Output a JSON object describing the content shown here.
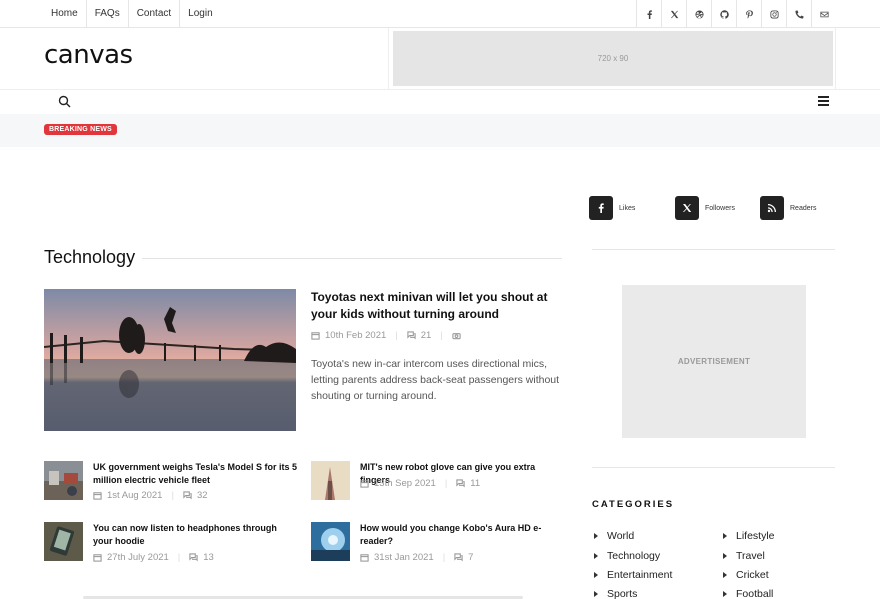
{
  "topnav": [
    "Home",
    "FAQs",
    "Contact",
    "Login"
  ],
  "social_icons": [
    "facebook-icon",
    "x-icon",
    "dribbble-icon",
    "github-icon",
    "pinterest-icon",
    "instagram-icon",
    "phone-icon",
    "email-icon"
  ],
  "header": {
    "logo": "canvas",
    "banner_text": "720 x 90"
  },
  "breaking": {
    "badge": "BREAKING NEWS"
  },
  "section": {
    "title": "Technology"
  },
  "featured": {
    "title": "Toyotas next minivan will let you shout at your kids without turning around",
    "date": "10th Feb 2021",
    "comments": "21",
    "excerpt": "Toyota's new in-car intercom uses directional mics, letting parents address back-seat passengers without shouting or turning around."
  },
  "posts": [
    {
      "title": "UK government weighs Tesla's Model S for its 5 million electric vehicle fleet",
      "date": "1st Aug 2021",
      "comments": "32"
    },
    {
      "title": "MIT's new robot glove can give you extra fingers",
      "date": "13th Sep 2021",
      "comments": "11"
    },
    {
      "title": "You can now listen to headphones through your hoodie",
      "date": "27th July 2021",
      "comments": "13"
    },
    {
      "title": "How would you change Kobo's Aura HD e-reader?",
      "date": "31st Jan 2021",
      "comments": "7"
    }
  ],
  "sidebar": {
    "social": [
      {
        "icon": "facebook-icon",
        "label": "Likes"
      },
      {
        "icon": "x-icon",
        "label": "Followers"
      },
      {
        "icon": "rss-icon",
        "label": "Readers"
      }
    ],
    "ad_text": "ADVERTISEMENT",
    "categories_title": "CATEGORIES",
    "categories": [
      "World",
      "Lifestyle",
      "Technology",
      "Travel",
      "Entertainment",
      "Cricket",
      "Sports",
      "Football"
    ]
  },
  "colors": {
    "badge": "#e0363c",
    "text": "#222222",
    "muted": "#999999"
  }
}
